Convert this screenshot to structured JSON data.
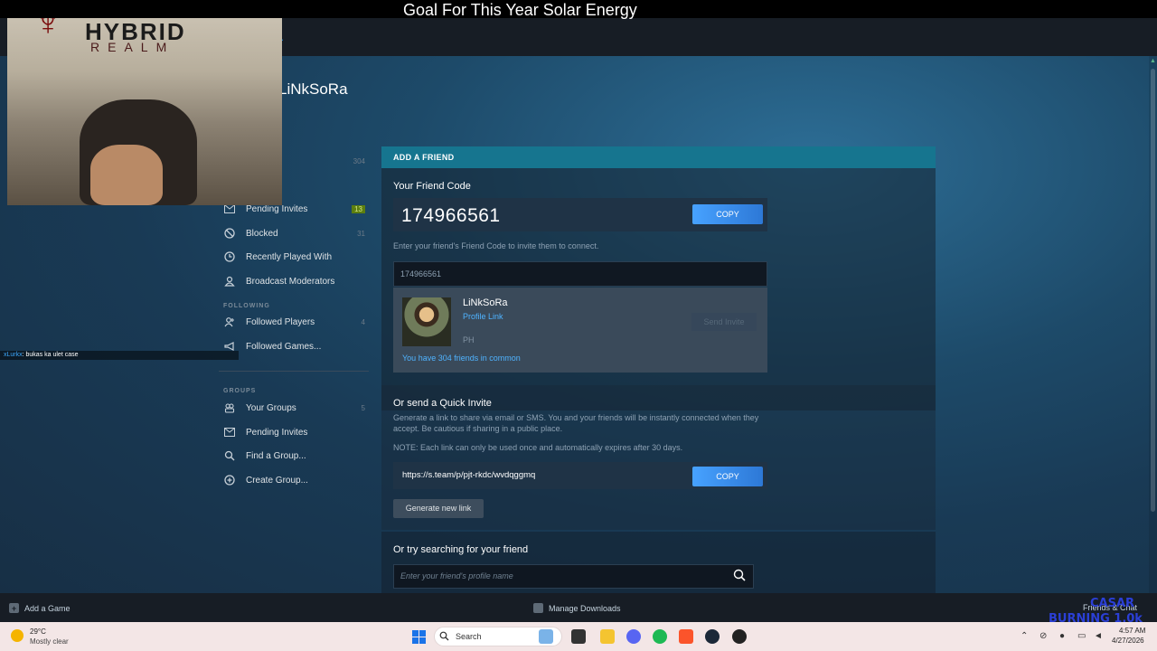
{
  "stream": {
    "title": "Goal For This Year Solar Energy",
    "logo_top": "HYBRID",
    "logo_bottom": "REALM",
    "chat_user": "xLurkx",
    "chat_message": ": bukas ka ulet case"
  },
  "profile": {
    "name": "LiNkSoRa"
  },
  "sidebar": {
    "items": [
      {
        "label": "nds",
        "count": "304"
      },
      {
        "label": "end",
        "count": ""
      },
      {
        "label": "Pending Invites",
        "count": "13"
      },
      {
        "label": "Blocked",
        "count": "31"
      },
      {
        "label": "Recently Played With",
        "count": ""
      },
      {
        "label": "Broadcast Moderators",
        "count": ""
      }
    ],
    "following_header": "FOLLOWING",
    "following": [
      {
        "label": "Followed Players",
        "count": "4"
      },
      {
        "label": "Followed Games...",
        "count": ""
      }
    ],
    "groups_header": "GROUPS",
    "groups": [
      {
        "label": "Your Groups",
        "count": "5"
      },
      {
        "label": "Pending Invites",
        "count": ""
      },
      {
        "label": "Find a Group...",
        "count": ""
      },
      {
        "label": "Create Group...",
        "count": ""
      }
    ]
  },
  "add_friend": {
    "header": "ADD A FRIEND",
    "code_title": "Your Friend Code",
    "code_value": "174966561",
    "copy_label": "COPY",
    "hint": "Enter your friend's Friend Code to invite them to connect.",
    "input_value": "174966561",
    "result": {
      "name": "LiNkSoRa",
      "profile_link": "Profile Link",
      "country": "PH",
      "send_invite": "Send Invite",
      "common": "You have 304 friends in common"
    }
  },
  "quick_invite": {
    "title": "Or send a Quick Invite",
    "desc": "Generate a link to share via email or SMS. You and your friends will be instantly connected when they accept. Be cautious if sharing in a public place.",
    "note": "NOTE: Each link can only be used once and automatically expires after 30 days.",
    "link": "https://s.team/p/pjt-rkdc/wvdqggmq",
    "copy_label": "COPY",
    "generate_label": "Generate new link"
  },
  "search_friend": {
    "title": "Or try searching for your friend",
    "placeholder": "Enter your friend's profile name"
  },
  "bottom_bar": {
    "add_game": "Add a Game",
    "manage_downloads": "Manage Downloads",
    "friends_chat": "Friends & Chat"
  },
  "overlay": {
    "line1": "CASAR",
    "line2": "BURNING 1.0k"
  },
  "taskbar": {
    "temperature": "29°C",
    "weather": "Mostly clear",
    "search_label": "Search",
    "time": "4:57 AM",
    "date": "4/27/2026"
  },
  "colors": {
    "accent": "#1a9fff",
    "panel_header": "#16758f",
    "copy_button": "#47a2ff",
    "badge": "#5c7e10"
  }
}
